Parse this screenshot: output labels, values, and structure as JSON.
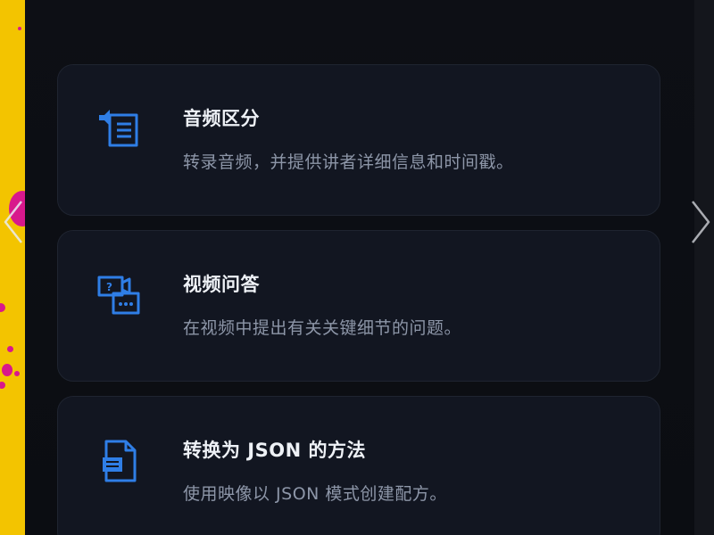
{
  "accent_color": "#2f7ee6",
  "cards": [
    {
      "icon": "audio-transcript-icon",
      "title": "音频区分",
      "description": "转录音频，并提供讲者详细信息和时间戳。"
    },
    {
      "icon": "video-question-icon",
      "title": "视频问答",
      "description": "在视频中提出有关关键细节的问题。"
    },
    {
      "icon": "document-json-icon",
      "title": "转换为 JSON 的方法",
      "description": "使用映像以 JSON 模式创建配方。"
    }
  ],
  "navigation": {
    "prev_icon": "chevron-left-icon",
    "next_icon": "chevron-right-icon"
  }
}
